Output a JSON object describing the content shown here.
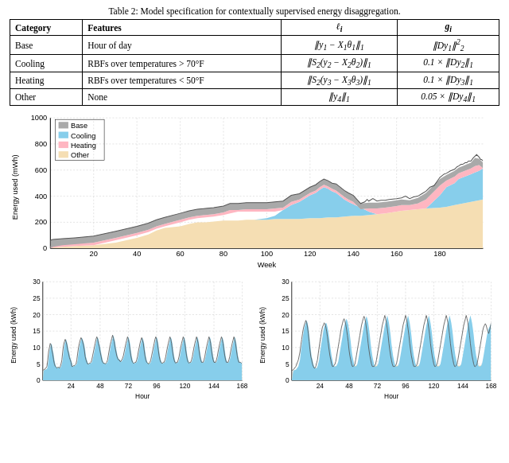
{
  "table": {
    "caption": "Table 2:  Model specification for contextually supervised energy disaggregation.",
    "headers": [
      "Category",
      "Features",
      "ℓᵢ",
      "gᵢ"
    ],
    "rows": [
      {
        "category": "Base",
        "features": "Hour of day",
        "li": "‖y₁ − X₁θ₁‖₁",
        "gi": "‖Dy₁‖²₂"
      },
      {
        "category": "Cooling",
        "features": "RBFs over temperatures > 70°F",
        "li": "‖S₂(y₂ − X₂θ₂)‖₁",
        "gi": "0.1 × ‖Dy₂‖₁"
      },
      {
        "category": "Heating",
        "features": "RBFs over temperatures < 50°F",
        "li": "‖S₂(y₃ − X₃θ₃)‖₁",
        "gi": "0.1 × ‖Dy₃‖₁"
      },
      {
        "category": "Other",
        "features": "None",
        "li": "‖y₄‖₁",
        "gi": "0.05 × ‖Dy₄‖₁"
      }
    ]
  },
  "main_chart": {
    "y_label": "Energy used (mWh)",
    "x_label": "Week",
    "y_max": 1000,
    "y_ticks": [
      0,
      200,
      400,
      600,
      800,
      1000
    ],
    "x_ticks": [
      20,
      40,
      60,
      80,
      100,
      120,
      140,
      160,
      180
    ],
    "legend": [
      "Base",
      "Cooling",
      "Heating",
      "Other"
    ]
  },
  "small_chart_left": {
    "y_label": "Energy used (kWh)",
    "x_label": "Hour",
    "y_max": 30,
    "y_ticks": [
      0,
      5,
      10,
      15,
      20,
      25,
      30
    ],
    "x_ticks": [
      24,
      48,
      72,
      96,
      120,
      144,
      168
    ]
  },
  "small_chart_right": {
    "y_label": "Energy used (kWh)",
    "x_label": "Hour",
    "y_max": 30,
    "y_ticks": [
      0,
      5,
      10,
      15,
      20,
      25,
      30
    ],
    "x_ticks": [
      24,
      48,
      72,
      96,
      120,
      144,
      168
    ]
  },
  "colors": {
    "base": "#f5deb3",
    "cooling": "#87ceeb",
    "heating": "#ffb6c1",
    "other": "#c0c0c0",
    "grid": "#ccc",
    "line": "#555"
  }
}
